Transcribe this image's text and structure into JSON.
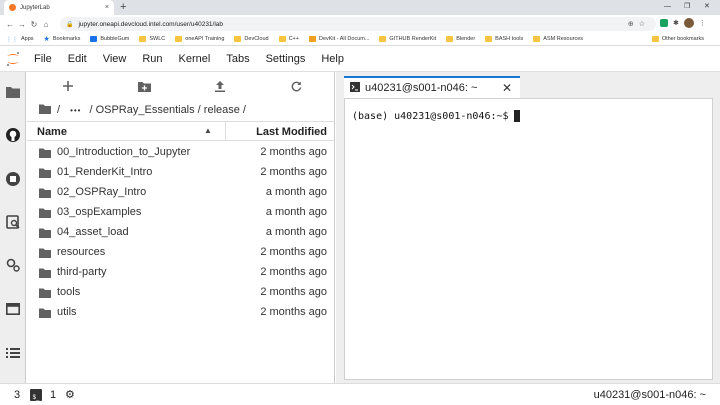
{
  "browser": {
    "tab_title": "JupyterLab",
    "tab_close": "×",
    "new_tab": "+",
    "window_controls": [
      "—",
      "❐",
      "✕"
    ],
    "url": "jupyter.oneapi.devcloud.intel.com/user/u40231/lab",
    "bookmarks": [
      "Apps",
      "Bookmarks",
      "BubbleGum",
      "SWLC",
      "oneAPI Training",
      "DevCloud",
      "C++",
      "DevKit - All Docum...",
      "GITHUB RenderKit",
      "Blender",
      "BASH tools",
      "ASM Resources"
    ],
    "other_bookmarks": "Other bookmarks"
  },
  "menu": [
    "File",
    "Edit",
    "View",
    "Run",
    "Kernel",
    "Tabs",
    "Settings",
    "Help"
  ],
  "filebrowser": {
    "breadcrumb_sep": "/",
    "breadcrumb_ellipsis": "•••",
    "breadcrumb_tail": "/ OSPRay_Essentials / release /",
    "col_name": "Name",
    "col_modified": "Last Modified",
    "files": [
      {
        "name": "00_Introduction_to_Jupyter",
        "modified": "2 months ago"
      },
      {
        "name": "01_RenderKit_Intro",
        "modified": "2 months ago"
      },
      {
        "name": "02_OSPRay_Intro",
        "modified": "a month ago"
      },
      {
        "name": "03_ospExamples",
        "modified": "a month ago"
      },
      {
        "name": "04_asset_load",
        "modified": "a month ago"
      },
      {
        "name": "resources",
        "modified": "2 months ago"
      },
      {
        "name": "third-party",
        "modified": "2 months ago"
      },
      {
        "name": "tools",
        "modified": "2 months ago"
      },
      {
        "name": "utils",
        "modified": "2 months ago"
      }
    ]
  },
  "terminal": {
    "tab_label": "u40231@s001-n046: ~",
    "tab_close": "✕",
    "prompt": "(base) u40231@s001-n046:~$"
  },
  "status": {
    "count": "3",
    "terminal_icon": "$_",
    "terminal_count": "1",
    "right_text": "u40231@s001-n046: ~"
  },
  "colors": {
    "accent": "#1976d2",
    "jupyter_orange": "#f37726",
    "sidebar": "#eeeeee"
  }
}
